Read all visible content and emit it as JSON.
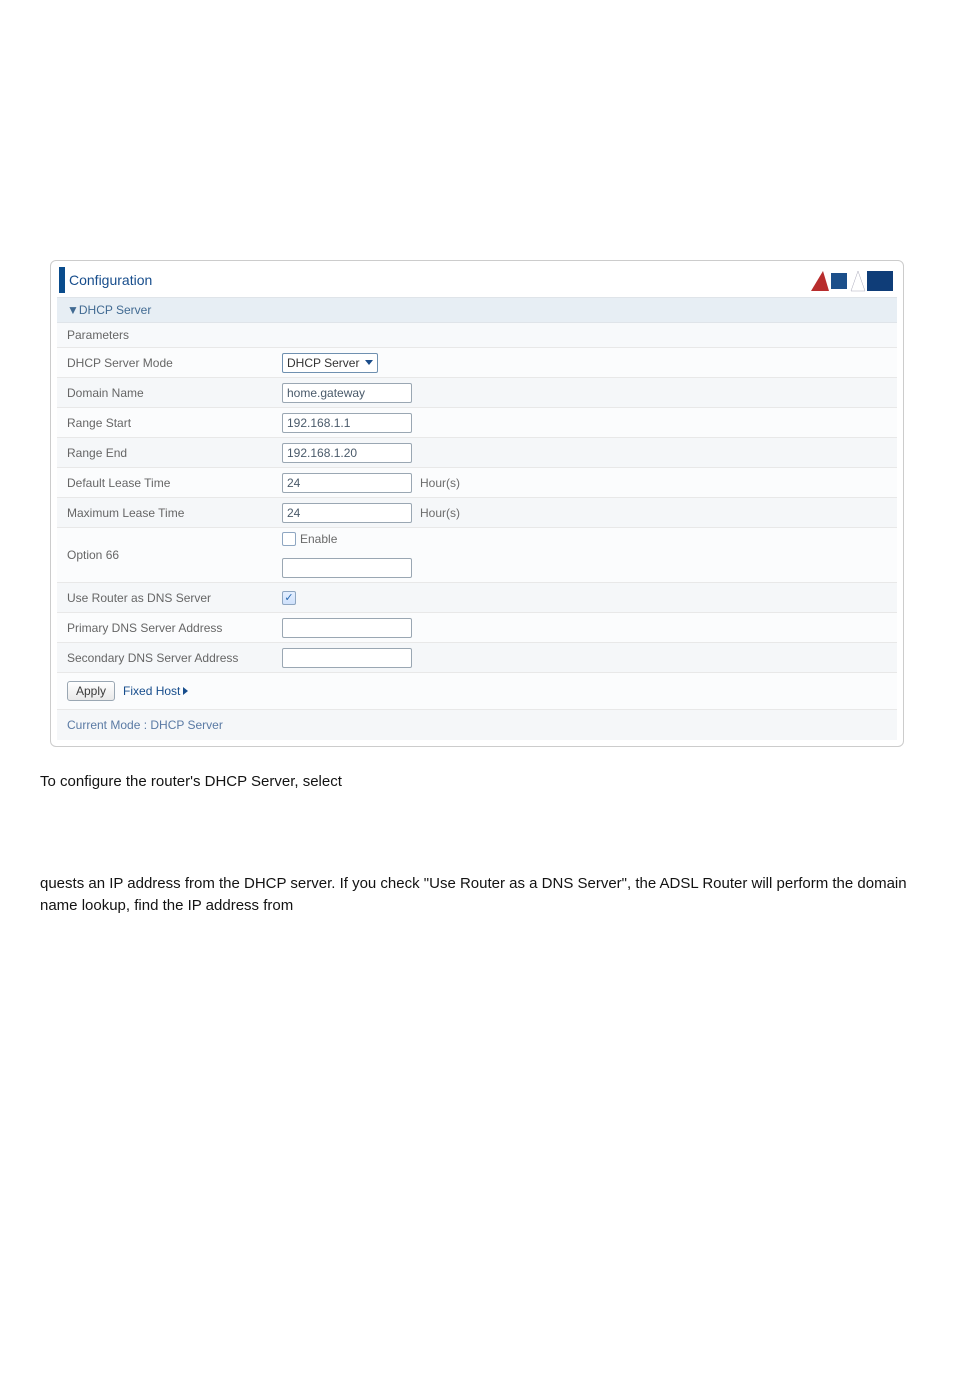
{
  "panel": {
    "title": "Configuration",
    "section": "▼DHCP Server",
    "parameters": "Parameters",
    "currentMode": "Current Mode : DHCP Server"
  },
  "rows": {
    "serverMode": {
      "label": "DHCP Server Mode",
      "selected": "DHCP Server"
    },
    "domainName": {
      "label": "Domain Name",
      "value": "home.gateway"
    },
    "rangeStart": {
      "label": "Range Start",
      "value": "192.168.1.1"
    },
    "rangeEnd": {
      "label": "Range End",
      "value": "192.168.1.20"
    },
    "defaultLease": {
      "label": "Default Lease Time",
      "value": "24",
      "unit": "Hour(s)"
    },
    "maxLease": {
      "label": "Maximum Lease Time",
      "value": "24",
      "unit": "Hour(s)"
    },
    "option66": {
      "label": "Option 66",
      "enableLabel": "Enable",
      "value": ""
    },
    "useRouterDns": {
      "label": "Use Router as DNS Server",
      "checked": true
    },
    "primaryDns": {
      "label": "Primary DNS Server Address",
      "value": ""
    },
    "secondaryDns": {
      "label": "Secondary DNS Server Address",
      "value": ""
    }
  },
  "actions": {
    "apply": "Apply",
    "fixedHost": "Fixed Host"
  },
  "text": {
    "p1": "To configure the router's DHCP Server, select",
    "p2": "quests an IP address from the DHCP server. If you check \"Use Router as a DNS Server\", the ADSL Router will perform the domain name lookup, find the IP address from"
  }
}
